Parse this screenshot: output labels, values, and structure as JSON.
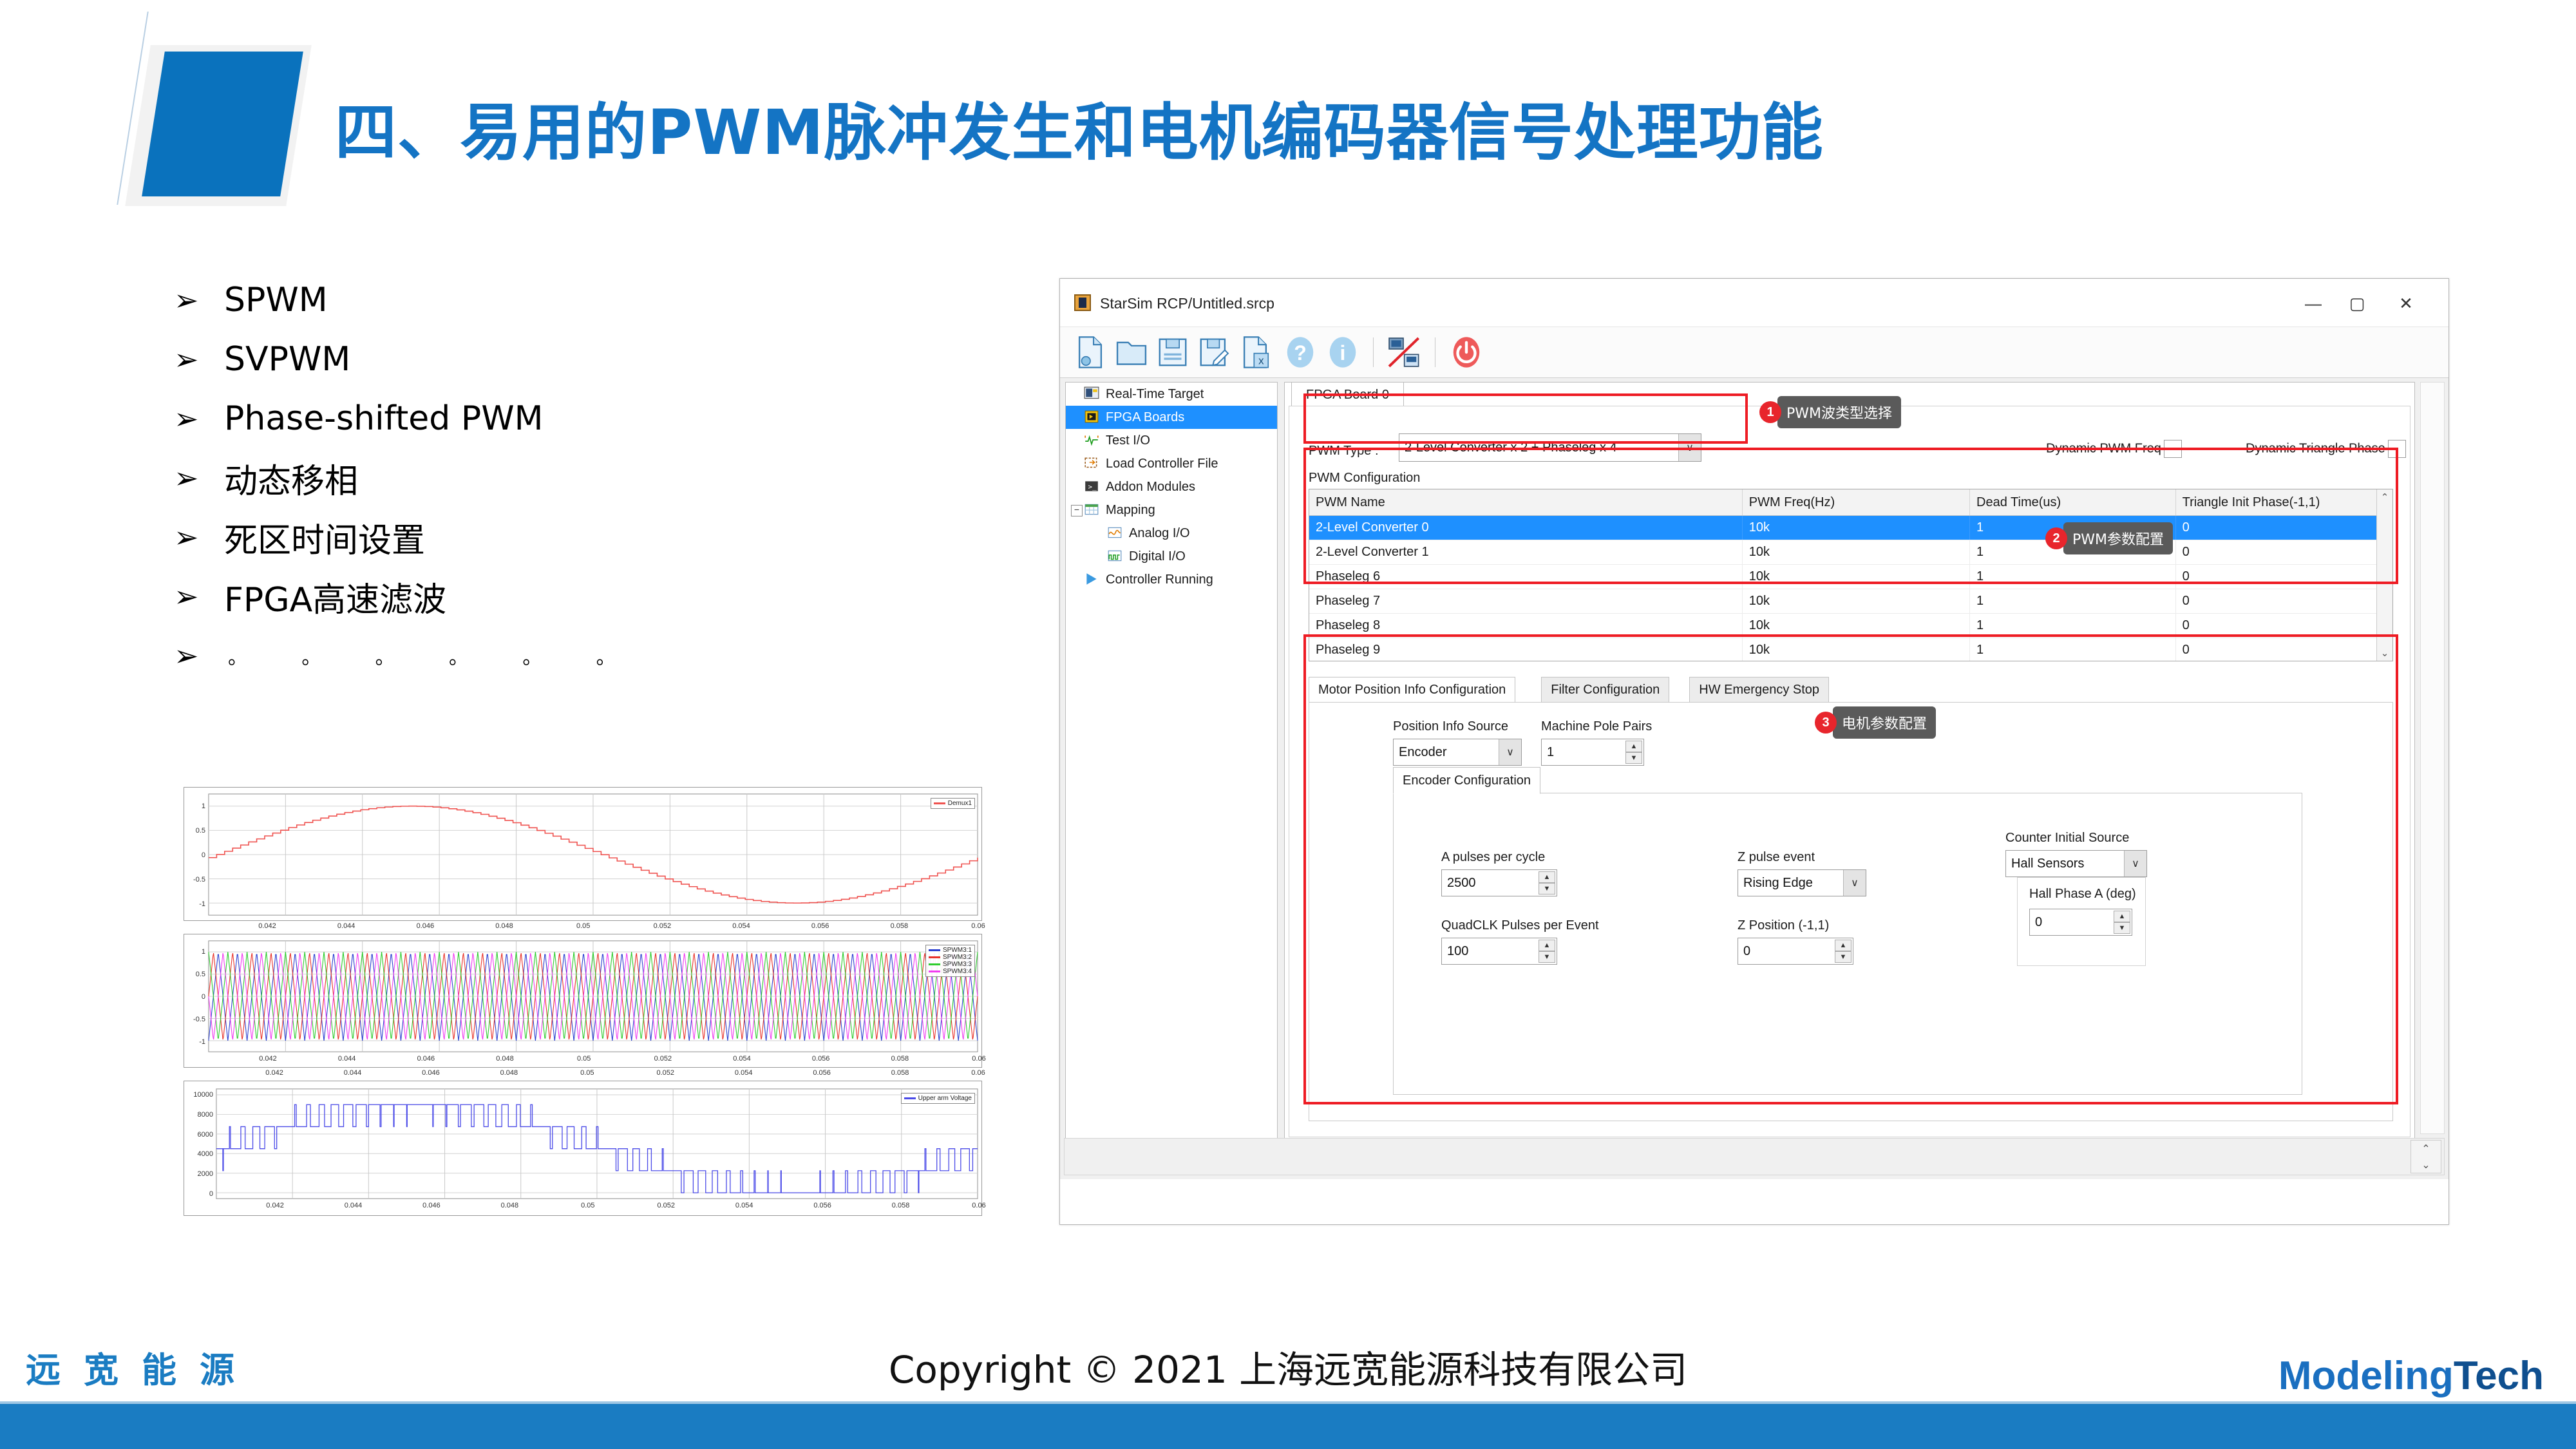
{
  "slide": {
    "title": "四、易用的PWM脉冲发生和电机编码器信号处理功能",
    "bullets": [
      {
        "arrow": "➢",
        "text": "SPWM"
      },
      {
        "arrow": "➢",
        "text": "SVPWM"
      },
      {
        "arrow": "➢",
        "text": "Phase-shifted PWM"
      },
      {
        "arrow": "➢",
        "text": "动态移相"
      },
      {
        "arrow": "➢",
        "text": "死区时间设置"
      },
      {
        "arrow": "➢",
        "text": "FPGA高速滤波"
      },
      {
        "arrow": "➢",
        "text": "。 。 。 。 。 。"
      }
    ]
  },
  "footer": {
    "copyright": "Copyright © 2021 上海远宽能源科技有限公司",
    "logo_left": "远宽能源",
    "logo_right_a": "Modeling",
    "logo_right_b": "Tech",
    "bar_color": "#1a7cc2"
  },
  "window": {
    "title": "StarSim RCP/Untitled.srcp",
    "app_icon": "starsim-app-icon",
    "controls": {
      "minimize": "—",
      "maximize": "▢",
      "close": "✕"
    },
    "toolbar": [
      {
        "name": "new-file-icon"
      },
      {
        "name": "open-folder-icon"
      },
      {
        "name": "save-icon"
      },
      {
        "name": "save-as-icon"
      },
      {
        "name": "close-file-icon"
      },
      {
        "name": "help-icon",
        "glyph": "?"
      },
      {
        "name": "info-icon",
        "glyph": "i"
      },
      {
        "name": "disconnect-target-icon"
      },
      {
        "name": "power-icon"
      }
    ],
    "tree": [
      {
        "label": "Real-Time Target",
        "icon": "real-time-target-icon",
        "selected": false,
        "child": false,
        "expander": ""
      },
      {
        "label": "FPGA Boards",
        "icon": "fpga-board-icon",
        "selected": true,
        "child": false,
        "expander": ""
      },
      {
        "label": "Test I/O",
        "icon": "test-io-icon",
        "selected": false,
        "child": false,
        "expander": ""
      },
      {
        "label": "Load Controller File",
        "icon": "load-controller-icon",
        "selected": false,
        "child": false,
        "expander": ""
      },
      {
        "label": "Addon Modules",
        "icon": "addon-modules-icon",
        "selected": false,
        "child": false,
        "expander": ""
      },
      {
        "label": "Mapping",
        "icon": "mapping-icon",
        "selected": false,
        "child": false,
        "expander": "−"
      },
      {
        "label": "Analog I/O",
        "icon": "analog-io-icon",
        "selected": false,
        "child": true,
        "expander": ""
      },
      {
        "label": "Digital I/O",
        "icon": "digital-io-icon",
        "selected": false,
        "child": true,
        "expander": ""
      },
      {
        "label": "Controller Running",
        "icon": "controller-running-icon",
        "selected": false,
        "child": false,
        "expander": ""
      }
    ],
    "board_tab": "FPGA Board 0",
    "pwm_type": {
      "label": "PWM Type :",
      "value": "2-Level Converter x 2 + Phaseleg x 4"
    },
    "dynamic_pwm_freq": {
      "label": "Dynamic PWM Freq",
      "checked": false
    },
    "dynamic_triangle_phase": {
      "label": "Dynamic Triangle Phase",
      "checked": false
    },
    "pwm_configuration": {
      "group_title": "PWM Configuration",
      "columns": [
        "PWM Name",
        "PWM Freq(Hz)",
        "Dead Time(us)",
        "Triangle Init Phase(-1,1)"
      ],
      "rows": [
        {
          "name": "2-Level Converter 0",
          "freq": "10k",
          "dead_time": "1",
          "phase": "0",
          "selected": true
        },
        {
          "name": "2-Level Converter 1",
          "freq": "10k",
          "dead_time": "1",
          "phase": "0",
          "selected": false
        },
        {
          "name": "Phaseleg 6",
          "freq": "10k",
          "dead_time": "1",
          "phase": "0",
          "selected": false
        },
        {
          "name": "Phaseleg 7",
          "freq": "10k",
          "dead_time": "1",
          "phase": "0",
          "selected": false
        },
        {
          "name": "Phaseleg 8",
          "freq": "10k",
          "dead_time": "1",
          "phase": "0",
          "selected": false
        },
        {
          "name": "Phaseleg 9",
          "freq": "10k",
          "dead_time": "1",
          "phase": "0",
          "selected": false
        }
      ],
      "scroll_up": "⌃",
      "scroll_down": "⌄"
    },
    "tabs": [
      {
        "label": "Motor Position Info Configuration",
        "active": true
      },
      {
        "label": "Filter Configuration",
        "active": false
      },
      {
        "label": "HW Emergency Stop",
        "active": false
      }
    ],
    "motor_position": {
      "position_info_source": {
        "label": "Position Info Source",
        "value": "Encoder"
      },
      "machine_pole_pairs": {
        "label": "Machine Pole Pairs",
        "value": "1"
      }
    },
    "encoder_configuration": {
      "tab_label": "Encoder Configuration",
      "a_pulses_per_cycle": {
        "label": "A pulses per cycle",
        "value": "2500"
      },
      "quadclk_pulses_per_event": {
        "label": "QuadCLK Pulses per Event",
        "value": "100"
      },
      "z_pulse_event": {
        "label": "Z pulse event",
        "value": "Rising Edge"
      },
      "z_position": {
        "label": "Z Position (-1,1)",
        "value": "0"
      },
      "counter_initial_source": {
        "label": "Counter Initial Source",
        "value": "Hall Sensors"
      },
      "hall_phase_a": {
        "label": "Hall Phase A (deg)",
        "value": "0"
      }
    },
    "callouts": [
      {
        "num": "1",
        "text": "PWM波类型选择"
      },
      {
        "num": "2",
        "text": "PWM参数配置"
      },
      {
        "num": "3",
        "text": "电机参数配置"
      }
    ],
    "annotation_color": "#ee1c24"
  },
  "chart_data": [
    {
      "type": "line",
      "title": "",
      "xlabel": "",
      "ylabel": "",
      "ylim": [
        -1.25,
        1.25
      ],
      "yticks": [
        1,
        0.5,
        0,
        -0.5,
        -1
      ],
      "ytick_labels": [
        "1",
        "0.5",
        "0",
        "-0.5",
        "-1"
      ],
      "xlim": [
        0.0405,
        0.06
      ],
      "xticks": [],
      "xtick_labels": [],
      "grid": true,
      "legend_position": "top-right",
      "series": [
        {
          "name": "Demux1",
          "color": "#ef5350",
          "description": "stepped sine modulation reference, amplitude 1, one period across window"
        }
      ]
    },
    {
      "type": "line",
      "title": "",
      "xlabel": "",
      "ylabel": "",
      "ylim": [
        -1.25,
        1.25
      ],
      "yticks": [
        1,
        0.5,
        0,
        -0.5,
        -1
      ],
      "ytick_labels": [
        "1",
        "0.5",
        "0",
        "-0.5",
        "-1"
      ],
      "xlim": [
        0.0405,
        0.06
      ],
      "xticks": [
        0.042,
        0.044,
        0.046,
        0.048,
        0.05,
        0.052,
        0.054,
        0.056,
        0.058,
        0.06
      ],
      "xtick_labels": [
        "0.042",
        "0.044",
        "0.046",
        "0.048",
        "0.05",
        "0.052",
        "0.054",
        "0.056",
        "0.058",
        "0.06"
      ],
      "grid": true,
      "legend_position": "top-right",
      "series": [
        {
          "name": "SPWM3:1",
          "color": "#2b3fd0",
          "description": "triangle carrier, 10 kHz, phase 0"
        },
        {
          "name": "SPWM3:2",
          "color": "#e8322a",
          "description": "triangle carrier, 10 kHz, phase shifted 90 deg"
        },
        {
          "name": "SPWM3:3",
          "color": "#2ecc2e",
          "description": "triangle carrier, 10 kHz, phase shifted 180 deg"
        },
        {
          "name": "SPWM3:4",
          "color": "#f03cf0",
          "description": "triangle carrier, 10 kHz, phase shifted 270 deg"
        }
      ]
    },
    {
      "type": "line",
      "title": "",
      "xlabel": "",
      "ylabel": "",
      "ylim": [
        -600,
        10600
      ],
      "yticks": [
        10000,
        8000,
        6000,
        4000,
        2000,
        0
      ],
      "ytick_labels": [
        "10000",
        "8000",
        "6000",
        "4000",
        "2000",
        "0"
      ],
      "xlim": [
        0.0405,
        0.06
      ],
      "xticks": [
        0.042,
        0.044,
        0.046,
        0.048,
        0.05,
        0.052,
        0.054,
        0.056,
        0.058,
        0.06
      ],
      "xtick_labels": [
        "0.042",
        "0.044",
        "0.046",
        "0.048",
        "0.05",
        "0.052",
        "0.054",
        "0.056",
        "0.058",
        "0.06"
      ],
      "grid": true,
      "legend_position": "top-right",
      "series": [
        {
          "name": "Upper arm Voltage",
          "color": "#4a4ae8",
          "description": "multilevel staircase PWM output stepping between 0 and 9000 V"
        }
      ]
    }
  ]
}
